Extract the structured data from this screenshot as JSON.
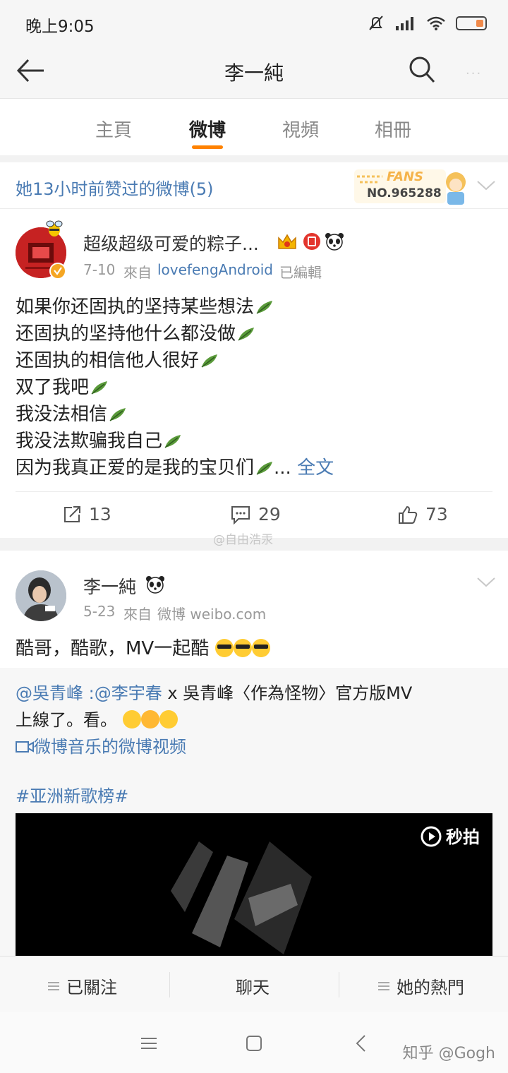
{
  "status_bar": {
    "time": "晚上9:05"
  },
  "nav": {
    "title": "李一純"
  },
  "tabs": [
    {
      "label": "主頁"
    },
    {
      "label": "微博"
    },
    {
      "label": "視頻"
    },
    {
      "label": "相冊"
    }
  ],
  "liked_bar": {
    "text": "她13小时前赞过的微博(5)",
    "fans_label": "FANS",
    "fans_no": "NO.965288"
  },
  "post1": {
    "username": "超级超级可爱的粽子...",
    "date": "7-10",
    "source_prefix": "來自",
    "source": "lovefengAndroid",
    "edited": "已編輯",
    "lines": [
      "如果你还固执的坚持某些想法",
      "还固执的坚持他什么都没做",
      "还固执的相信他人很好",
      "双了我吧",
      "我没法相信",
      "我没法欺骗我自己",
      "因为我真正爱的是我的宝贝们"
    ],
    "ellipsis": "...",
    "full_text_link": "全文",
    "reposts": "13",
    "comments": "29",
    "likes": "73"
  },
  "watermark": "@自由浩汞",
  "post2": {
    "username": "李一純",
    "date": "5-23",
    "source_prefix": "來自",
    "source": "微博 weibo.com",
    "text": "酷哥，酷歌，MV一起酷",
    "repost_mention1": "@吳青峰",
    "repost_sep": " :",
    "repost_mention2": "@李宇春",
    "repost_text1": " x 吳青峰〈作為怪物〉官方版MV",
    "repost_text2": "上線了。看。",
    "video_link": "微博音乐的微博视频",
    "hashtag": "#亚洲新歌榜#",
    "video_brand": "秒拍"
  },
  "bottom_actions": {
    "following": "已關注",
    "chat": "聊天",
    "hot": "她的熱門"
  },
  "attribution": "知乎 @Gogh",
  "colors": {
    "accent": "#ff8200",
    "link": "#4a7bb3",
    "fans_gold": "#f5b34a"
  }
}
